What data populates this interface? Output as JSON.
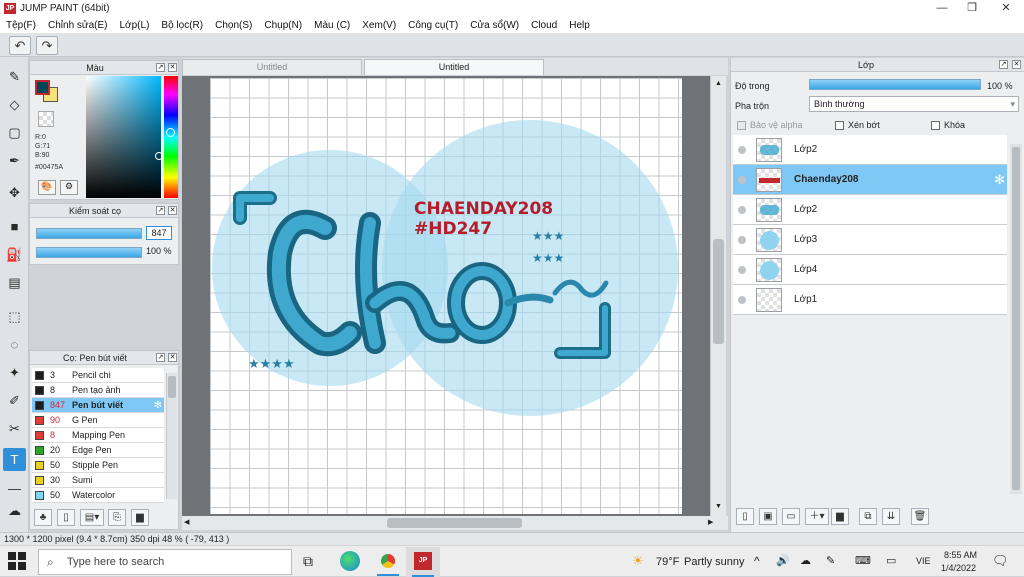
{
  "window": {
    "title": "JUMP PAINT (64bit)",
    "logo_text": "JP"
  },
  "menu": [
    "Tệp(F)",
    "Chỉnh sửa(E)",
    "Lớp(L)",
    "Bộ lọc(R)",
    "Chọn(S)",
    "Chụp(N)",
    "Màu (C)",
    "Xem(V)",
    "Công cụ(T)",
    "Cửa sổ(W)",
    "Cloud",
    "Help"
  ],
  "color_panel": {
    "title": "Màu",
    "r": "R:0",
    "g": "G:71",
    "b": "B:90",
    "hex": "#00475A",
    "fg_color": "#00475A",
    "bg_color": "#f5e27a"
  },
  "brush_control": {
    "title": "Kiểm soát cọ",
    "size": "847",
    "opacity": "100 %",
    "opacity_fraction": 1.0
  },
  "pen_panel": {
    "title": "Cọ: Pen bút viết",
    "items": [
      {
        "size": "3",
        "name": "Pencil chì",
        "color": "#1e1e1e"
      },
      {
        "size": "8",
        "name": "Pen tạo ảnh",
        "color": "#1e1e1e"
      },
      {
        "size": "847",
        "name": "Pen bút viết",
        "color": "#1e1e1e",
        "selected": true
      },
      {
        "size": "90",
        "name": "G Pen",
        "color": "#e03b3b"
      },
      {
        "size": "8",
        "name": "Mapping Pen",
        "color": "#e03b3b"
      },
      {
        "size": "20",
        "name": "Edge Pen",
        "color": "#2aa52a"
      },
      {
        "size": "50",
        "name": "Stipple Pen",
        "color": "#e8d21e"
      },
      {
        "size": "30",
        "name": "Sumi",
        "color": "#e8d21e"
      },
      {
        "size": "50",
        "name": "Watercolor",
        "color": "#7fd6f2"
      }
    ]
  },
  "canvas": {
    "tabs": [
      {
        "label": "Untitled",
        "active": false
      },
      {
        "label": "Untitled",
        "active": true
      }
    ],
    "artwork_text_1": "CHAENDAY208",
    "artwork_text_2": "#HD247",
    "lettering": "Cho"
  },
  "layer_panel": {
    "title": "Lớp",
    "opacity_label": "Độ trong",
    "opacity_value": "100 %",
    "blend_label": "Pha trộn",
    "blend_value": "Bình thường",
    "protect_alpha": "Bảo vệ alpha",
    "clip": "Xén bớt",
    "lock": "Khóa",
    "layers": [
      {
        "name": "Lớp2",
        "selected": false
      },
      {
        "name": "Chaenday208",
        "selected": true
      },
      {
        "name": "Lớp2",
        "selected": false
      },
      {
        "name": "Lớp3",
        "selected": false
      },
      {
        "name": "Lớp4",
        "selected": false
      },
      {
        "name": "Lớp1",
        "selected": false
      }
    ]
  },
  "status": {
    "dims": "1300 * 1200 pixel",
    "size_cm": "(9.4 * 8.7cm)",
    "dpi": "350 dpi",
    "zoom": "48 %",
    "coords": "( -79, 413 )"
  },
  "taskbar": {
    "search_placeholder": "Type here to search",
    "temperature": "79°F",
    "weather": "Partly sunny",
    "lang": "VIE",
    "time": "8:55 AM",
    "date": "1/4/2022"
  }
}
